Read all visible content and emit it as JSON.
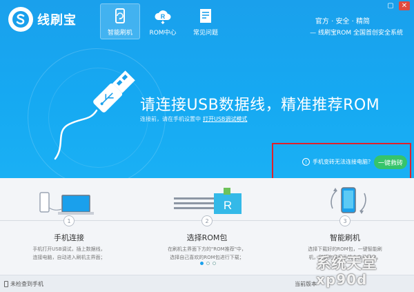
{
  "app": {
    "name": "线刷宝",
    "window_controls": {
      "minimize": "▢",
      "close": "✕"
    }
  },
  "nav": [
    {
      "label": "智能刷机",
      "icon": "smart-flash-icon",
      "active": true
    },
    {
      "label": "ROM中心",
      "icon": "rom-cloud-icon",
      "active": false
    },
    {
      "label": "常见问题",
      "icon": "faq-document-icon",
      "active": false
    }
  ],
  "top_links": {
    "official": "官方",
    "sep1": "·",
    "security": "安全",
    "sep2": "·",
    "quality": "精简"
  },
  "slogan": "—  线刷宝ROM  全国首创安全系统",
  "hero": {
    "headline": "请连接USB数据线，精准推荐ROM",
    "subline_prefix": "连接前，请在手机设置中",
    "subline_link": "打开USB调试模式"
  },
  "help": {
    "question": "手机变砖无法连接电脑？",
    "question_icon": "!",
    "rescue_button": "一键救砖"
  },
  "steps": [
    {
      "num": "1",
      "title": "手机连接",
      "desc": [
        "手机打开USB调试，插上数据线，",
        "连接电脑，自动进入刷机主界面；"
      ]
    },
    {
      "num": "2",
      "title": "选择ROM包",
      "desc": [
        "在刷机主界面下方的\"ROM推荐\"中，",
        "选择自己喜欢的ROM包进行下载；"
      ]
    },
    {
      "num": "3",
      "title": "智能刷机",
      "desc": [
        "选择下载好的ROM包，一键智能刷",
        "机，刷机完成后手机会自动重启。"
      ]
    }
  ],
  "illus": {
    "rom_letter": "R"
  },
  "pagination": {
    "count": 3,
    "active": 0
  },
  "status": {
    "left": "未检查到手机",
    "right": "当前版本"
  },
  "watermark": {
    "line1": "系统天堂",
    "line2": "xp90d"
  },
  "colors": {
    "hero_blue": "#1aa0ec",
    "rescue_green": "#36c46a",
    "highlight_red": "#e0202a"
  }
}
